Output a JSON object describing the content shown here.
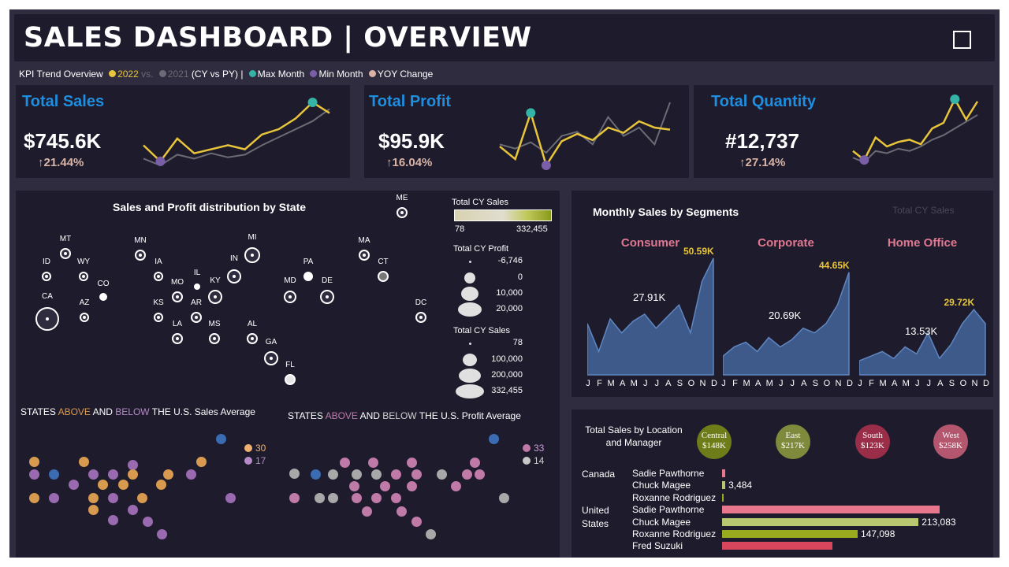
{
  "header": {
    "title": "SALES DASHBOARD | OVERVIEW",
    "menu_icon": "menu-icon"
  },
  "legend": {
    "prefix": "KPI Trend Overview",
    "cy": "2022",
    "vs": "vs.",
    "py": "2021",
    "suffix": "(CY vs PY)",
    "sep": "|",
    "max": "Max Month",
    "min": "Min Month",
    "yoy": "YOY Change",
    "colors": {
      "cy": "#e8c53a",
      "py": "#6b6b75",
      "max": "#35b3a6",
      "min": "#7b5ea8",
      "yoy": "#d9b4a6"
    }
  },
  "kpis": [
    {
      "title": "Total Sales",
      "value": "$745.6K",
      "change": "↑21.44%",
      "cy": [
        40,
        28,
        45,
        34,
        37,
        40,
        37,
        48,
        52,
        60,
        72,
        64
      ],
      "py": [
        30,
        25,
        33,
        30,
        34,
        31,
        33,
        40,
        46,
        52,
        58,
        67
      ]
    },
    {
      "title": "Total Profit",
      "value": "$95.9K",
      "change": "↑16.04%",
      "cy": [
        20,
        8,
        52,
        2,
        25,
        32,
        26,
        38,
        33,
        44,
        38,
        36
      ],
      "py": [
        22,
        18,
        24,
        14,
        30,
        34,
        22,
        48,
        30,
        38,
        22,
        62
      ]
    },
    {
      "title": "Total Quantity",
      "value": "#12,737",
      "change": "↑27.14%",
      "cy": [
        30,
        22,
        42,
        34,
        38,
        40,
        36,
        50,
        55,
        76,
        58,
        74
      ],
      "py": [
        24,
        20,
        30,
        28,
        32,
        30,
        34,
        40,
        44,
        50,
        56,
        62
      ]
    }
  ],
  "map": {
    "title": "Sales and Profit distribution by State",
    "states": [
      "ME",
      "MT",
      "MN",
      "MI",
      "MA",
      "ID",
      "WY",
      "IA",
      "IL",
      "IN",
      "PA",
      "CT",
      "CO",
      "MO",
      "KY",
      "MD",
      "DE",
      "CA",
      "AZ",
      "KS",
      "AR",
      "DC",
      "LA",
      "MS",
      "AL",
      "GA",
      "FL"
    ],
    "legend_sales_title": "Total CY Sales",
    "legend_sales_min": "78",
    "legend_sales_max": "332,455",
    "legend_profit_title": "Total CY Profit",
    "legend_profit_vals": [
      "-6,746",
      "0",
      "10,000",
      "20,000"
    ],
    "legend_size_title": "Total CY Sales",
    "legend_size_vals": [
      "78",
      "100,000",
      "200,000",
      "332,455"
    ]
  },
  "scatter_sales": {
    "title_pre": "STATES ",
    "above": "ABOVE",
    "mid": " AND ",
    "below": "BELOW",
    "title_post": " THE U.S. Sales Average",
    "above_count": "30",
    "below_count": "17",
    "above_color": "#d89a4e",
    "below_color": "#9a6ab0"
  },
  "scatter_profit": {
    "title_pre": "STATES ",
    "above": "ABOVE",
    "mid": " AND ",
    "below": "BELOW",
    "title_post": " THE U.S. Profit Average",
    "above_count": "33",
    "below_count": "14",
    "above_color": "#c07aa8",
    "below_color": "#a8a8a8"
  },
  "segments": {
    "title": "Monthly Sales by Segments",
    "faint_label": "Total CY Sales",
    "months": [
      "J",
      "F",
      "M",
      "A",
      "M",
      "J",
      "J",
      "A",
      "S",
      "O",
      "N",
      "D"
    ],
    "items": [
      {
        "name": "Consumer",
        "max": "50.59K",
        "avg": "27.91K",
        "values": [
          22,
          10,
          24,
          18,
          23,
          26,
          20,
          25,
          30,
          18,
          40,
          50
        ]
      },
      {
        "name": "Corporate",
        "max": "44.65K",
        "avg": "20.69K",
        "values": [
          8,
          12,
          14,
          10,
          16,
          12,
          15,
          20,
          18,
          22,
          30,
          44
        ]
      },
      {
        "name": "Home Office",
        "max": "29.72K",
        "avg": "13.53K",
        "values": [
          6,
          8,
          10,
          7,
          12,
          9,
          18,
          7,
          13,
          22,
          28,
          22
        ]
      }
    ]
  },
  "managers": {
    "title": "Total Sales by Location and Manager",
    "regions": [
      {
        "name": "Central",
        "value": "$148K",
        "color": "#6e7d1a"
      },
      {
        "name": "East",
        "value": "$217K",
        "color": "#7f8a3c"
      },
      {
        "name": "South",
        "value": "$123K",
        "color": "#9a2e48"
      },
      {
        "name": "West",
        "value": "$258K",
        "color": "#b3566e"
      }
    ],
    "countries": [
      "Canada",
      "United",
      "States"
    ],
    "rows": [
      {
        "name": "Sadie Pawthorne",
        "value": "",
        "sales": 3200,
        "color": "#e8768c"
      },
      {
        "name": "Chuck Magee",
        "value": "3,484",
        "sales": 3484,
        "color": "#b8c870"
      },
      {
        "name": "Roxanne Rodriguez",
        "value": "",
        "sales": 800,
        "color": "#9aaa1e"
      },
      {
        "name": "Sadie Pawthorne",
        "value": "",
        "sales": 236000,
        "color": "#e8768c"
      },
      {
        "name": "Chuck Magee",
        "value": "213,083",
        "sales": 213083,
        "color": "#b8c870"
      },
      {
        "name": "Roxanne Rodriguez",
        "value": "147,098",
        "sales": 147098,
        "color": "#9aaa1e"
      },
      {
        "name": "Fred Suzuki",
        "value": "",
        "sales": 120000,
        "color": "#d8465e"
      }
    ]
  }
}
